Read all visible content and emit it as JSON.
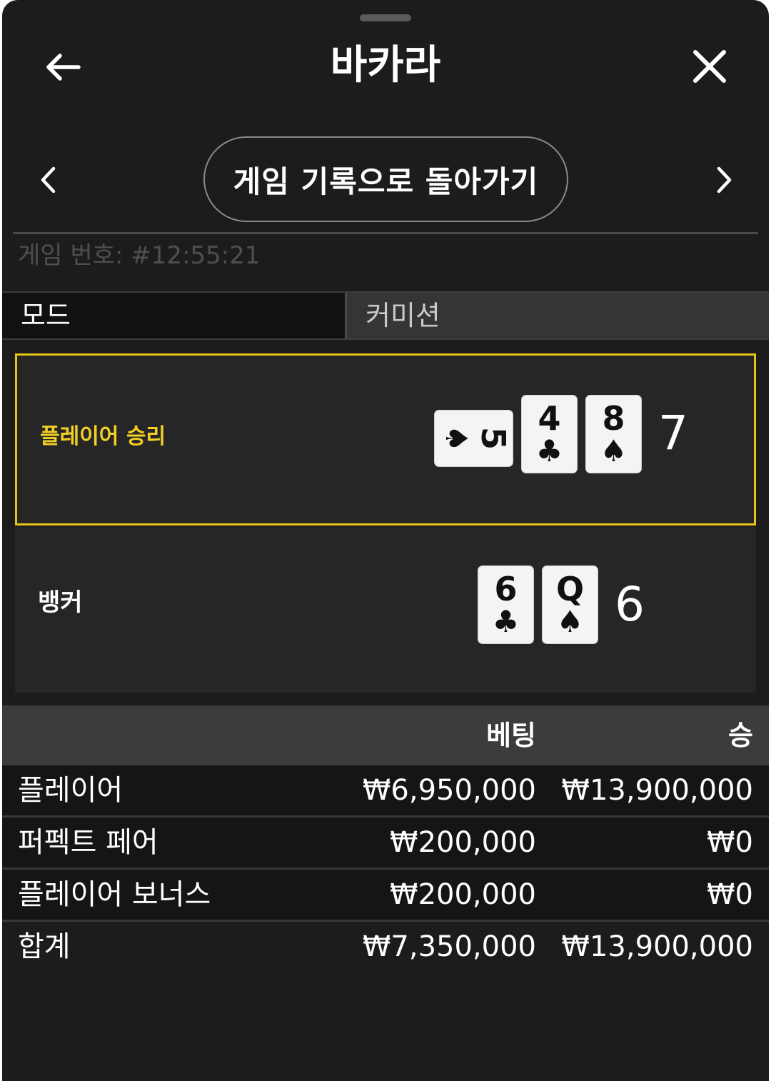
{
  "header": {
    "title": "바카라"
  },
  "nav": {
    "history_button": "게임 기록으로 돌아가기"
  },
  "game": {
    "number_label": "게임 번호: #12:55:21"
  },
  "tabs": [
    {
      "label": "모드"
    },
    {
      "label": "커미션"
    }
  ],
  "results": {
    "player": {
      "label": "플레이어 승리",
      "cards": [
        {
          "rank": "5",
          "suit": "♠",
          "orientation": "horizontal"
        },
        {
          "rank": "4",
          "suit": "♣",
          "orientation": "vertical"
        },
        {
          "rank": "8",
          "suit": "♠",
          "orientation": "vertical"
        }
      ],
      "score": "7"
    },
    "banker": {
      "label": "뱅커",
      "cards": [
        {
          "rank": "6",
          "suit": "♣",
          "orientation": "vertical"
        },
        {
          "rank": "Q",
          "suit": "♠",
          "orientation": "vertical"
        }
      ],
      "score": "6"
    }
  },
  "bets_table": {
    "headers": {
      "bet": "베팅",
      "win": "승"
    },
    "rows": [
      {
        "name": "플레이어",
        "bet": "₩6,950,000",
        "win": "₩13,900,000"
      },
      {
        "name": "퍼펙트 페어",
        "bet": "₩200,000",
        "win": "₩0"
      },
      {
        "name": "플레이어 보너스",
        "bet": "₩200,000",
        "win": "₩0"
      },
      {
        "name": "합계",
        "bet": "₩7,350,000",
        "win": "₩13,900,000"
      }
    ]
  },
  "colors": {
    "accent": "#e6c418",
    "panel_bg": "#1c1c1c",
    "header_row_bg": "#3c3c3c"
  },
  "icons": {
    "back": "arrow-left-icon",
    "close": "close-icon",
    "prev": "chevron-left-icon",
    "next": "chevron-right-icon"
  }
}
